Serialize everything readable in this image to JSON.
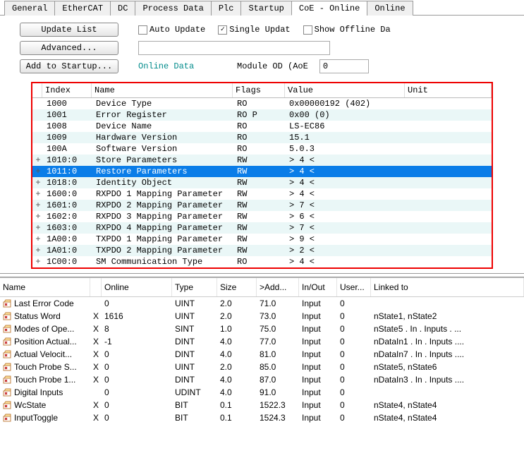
{
  "tabs": {
    "items": [
      "General",
      "EtherCAT",
      "DC",
      "Process Data",
      "Plc",
      "Startup",
      "CoE - Online",
      "Online"
    ],
    "active": 6
  },
  "toolbar": {
    "update_list": "Update List",
    "advanced": "Advanced...",
    "add_startup": "Add to Startup...",
    "auto_update": "Auto Update",
    "single_update": "Single Updat",
    "show_offline": "Show Offline Da",
    "online_data": "Online Data",
    "module_od": "Module OD (AoE",
    "module_od_val": "0"
  },
  "coe": {
    "headers": {
      "index": "Index",
      "name": "Name",
      "flags": "Flags",
      "value": "Value",
      "unit": "Unit"
    },
    "rows": [
      {
        "exp": "",
        "idx": "1000",
        "name": "Device Type",
        "flags": "RO",
        "value": "0x00000192 (402)",
        "alt": false
      },
      {
        "exp": "",
        "idx": "1001",
        "name": "Error Register",
        "flags": "RO P",
        "value": "0x00 (0)",
        "alt": true
      },
      {
        "exp": "",
        "idx": "1008",
        "name": "Device Name",
        "flags": "RO",
        "value": "LS-EC86",
        "alt": false
      },
      {
        "exp": "",
        "idx": "1009",
        "name": "Hardware Version",
        "flags": "RO",
        "value": "15.1",
        "alt": true
      },
      {
        "exp": "",
        "idx": "100A",
        "name": "Software Version",
        "flags": "RO",
        "value": "5.0.3",
        "alt": false
      },
      {
        "exp": "+",
        "idx": "1010:0",
        "name": "Store Parameters",
        "flags": "RW",
        "value": "> 4 <",
        "alt": true
      },
      {
        "exp": "+",
        "idx": "1011:0",
        "name": "Restore Parameters",
        "flags": "RW",
        "value": "> 4 <",
        "sel": true
      },
      {
        "exp": "+",
        "idx": "1018:0",
        "name": "Identity Object",
        "flags": "RW",
        "value": "> 4 <",
        "alt": true
      },
      {
        "exp": "+",
        "idx": "1600:0",
        "name": "RXPDO 1 Mapping Parameter",
        "flags": "RW",
        "value": "> 4 <",
        "alt": false
      },
      {
        "exp": "+",
        "idx": "1601:0",
        "name": "RXPDO 2 Mapping Parameter",
        "flags": "RW",
        "value": "> 7 <",
        "alt": true
      },
      {
        "exp": "+",
        "idx": "1602:0",
        "name": "RXPDO 3 Mapping Parameter",
        "flags": "RW",
        "value": "> 6 <",
        "alt": false
      },
      {
        "exp": "+",
        "idx": "1603:0",
        "name": "RXPDO 4 Mapping Parameter",
        "flags": "RW",
        "value": "> 7 <",
        "alt": true
      },
      {
        "exp": "+",
        "idx": "1A00:0",
        "name": "TXPDO 1 Mapping Parameter",
        "flags": "RW",
        "value": "> 9 <",
        "alt": false
      },
      {
        "exp": "+",
        "idx": "1A01:0",
        "name": "TXPDO 2 Mapping Parameter",
        "flags": "RW",
        "value": "> 2 <",
        "alt": true
      },
      {
        "exp": "+",
        "idx": "1C00:0",
        "name": "SM Communication Type",
        "flags": "RO",
        "value": "> 4 <",
        "alt": false
      }
    ]
  },
  "lower": {
    "headers": {
      "name": "Name",
      "online": "Online",
      "type": "Type",
      "size": "Size",
      "addr": ">Add...",
      "io": "In/Out",
      "user": "User...",
      "linked": "Linked to"
    },
    "rows": [
      {
        "name": "Last Error Code",
        "x": "",
        "online": "0",
        "type": "UINT",
        "size": "2.0",
        "addr": "71.0",
        "io": "Input",
        "user": "0",
        "linked": ""
      },
      {
        "name": "Status Word",
        "x": "X",
        "online": "1616",
        "type": "UINT",
        "size": "2.0",
        "addr": "73.0",
        "io": "Input",
        "user": "0",
        "linked": "nState1, nState2"
      },
      {
        "name": "Modes of Ope...",
        "x": "X",
        "online": "8",
        "type": "SINT",
        "size": "1.0",
        "addr": "75.0",
        "io": "Input",
        "user": "0",
        "linked": "nState5 . In . Inputs . ..."
      },
      {
        "name": "Position Actual...",
        "x": "X",
        "online": "-1",
        "type": "DINT",
        "size": "4.0",
        "addr": "77.0",
        "io": "Input",
        "user": "0",
        "linked": "nDataIn1 . In . Inputs ...."
      },
      {
        "name": "Actual Velocit...",
        "x": "X",
        "online": "0",
        "type": "DINT",
        "size": "4.0",
        "addr": "81.0",
        "io": "Input",
        "user": "0",
        "linked": "nDataIn7 . In . Inputs ...."
      },
      {
        "name": "Touch Probe S...",
        "x": "X",
        "online": "0",
        "type": "UINT",
        "size": "2.0",
        "addr": "85.0",
        "io": "Input",
        "user": "0",
        "linked": "nState5, nState6"
      },
      {
        "name": "Touch Probe 1...",
        "x": "X",
        "online": "0",
        "type": "DINT",
        "size": "4.0",
        "addr": "87.0",
        "io": "Input",
        "user": "0",
        "linked": "nDataIn3 . In . Inputs ...."
      },
      {
        "name": "Digital Inputs",
        "x": "",
        "online": "0",
        "type": "UDINT",
        "size": "4.0",
        "addr": "91.0",
        "io": "Input",
        "user": "0",
        "linked": ""
      },
      {
        "name": "WcState",
        "x": "X",
        "online": "0",
        "type": "BIT",
        "size": "0.1",
        "addr": "1522.3",
        "io": "Input",
        "user": "0",
        "linked": "nState4, nState4"
      },
      {
        "name": "InputToggle",
        "x": "X",
        "online": "0",
        "type": "BIT",
        "size": "0.1",
        "addr": "1524.3",
        "io": "Input",
        "user": "0",
        "linked": "nState4, nState4"
      }
    ]
  }
}
